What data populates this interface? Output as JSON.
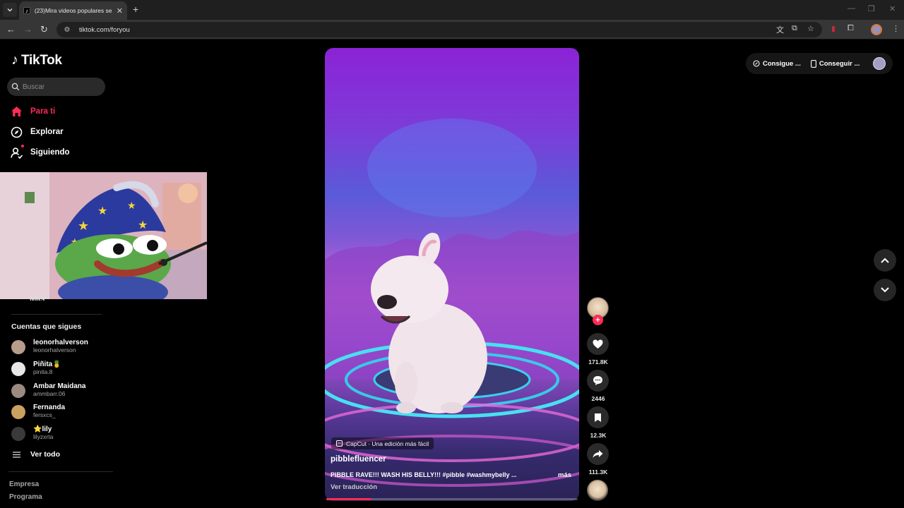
{
  "browser": {
    "tab_title": "(23)Mira videos populares sele",
    "url": "tiktok.com/foryou"
  },
  "tiktok": {
    "logo_text": "TikTok",
    "search_placeholder": "Buscar",
    "nav": [
      {
        "label": "Para ti",
        "icon": "home-icon",
        "active": true
      },
      {
        "label": "Explorar",
        "icon": "compass-icon",
        "active": false
      },
      {
        "label": "Siguiendo",
        "icon": "following-icon",
        "active": false,
        "dot": true
      }
    ],
    "more_label": "Más",
    "following_title": "Cuentas que sigues",
    "following": [
      {
        "name": "leonorhalverson",
        "user": "leonorhalverson",
        "color": "#b89c8c"
      },
      {
        "name": "Piñita🍍",
        "user": "pinita.8",
        "color": "#e8e8e8"
      },
      {
        "name": "Ambar Maidana",
        "user": "ammbarr.06",
        "color": "#9b8a80"
      },
      {
        "name": "Fernanda",
        "user": "fersxcs_",
        "color": "#c8a25e"
      },
      {
        "name": "⭐lily",
        "user": "lilyzxrta",
        "color": "#3a3a3a"
      }
    ],
    "see_all": "Ver todo",
    "footer": [
      "Empresa",
      "Programa"
    ]
  },
  "video": {
    "badge": "CapCut · Una edición más fácil",
    "author": "pibblefluencer",
    "caption": "PIBBLE RAVE!!! WASH HIS BELLY!!! #pibble #washmybelly ...",
    "more": "más",
    "translate": "Ver traducción",
    "progress": 0.18
  },
  "actions": {
    "likes": "171.8K",
    "comments": "2446",
    "saves": "12.3K",
    "shares": "111.3K"
  },
  "top_right": {
    "get_coins": "Consigue ...",
    "get_app": "Conseguir ..."
  },
  "colors": {
    "accent": "#fe2c55"
  }
}
